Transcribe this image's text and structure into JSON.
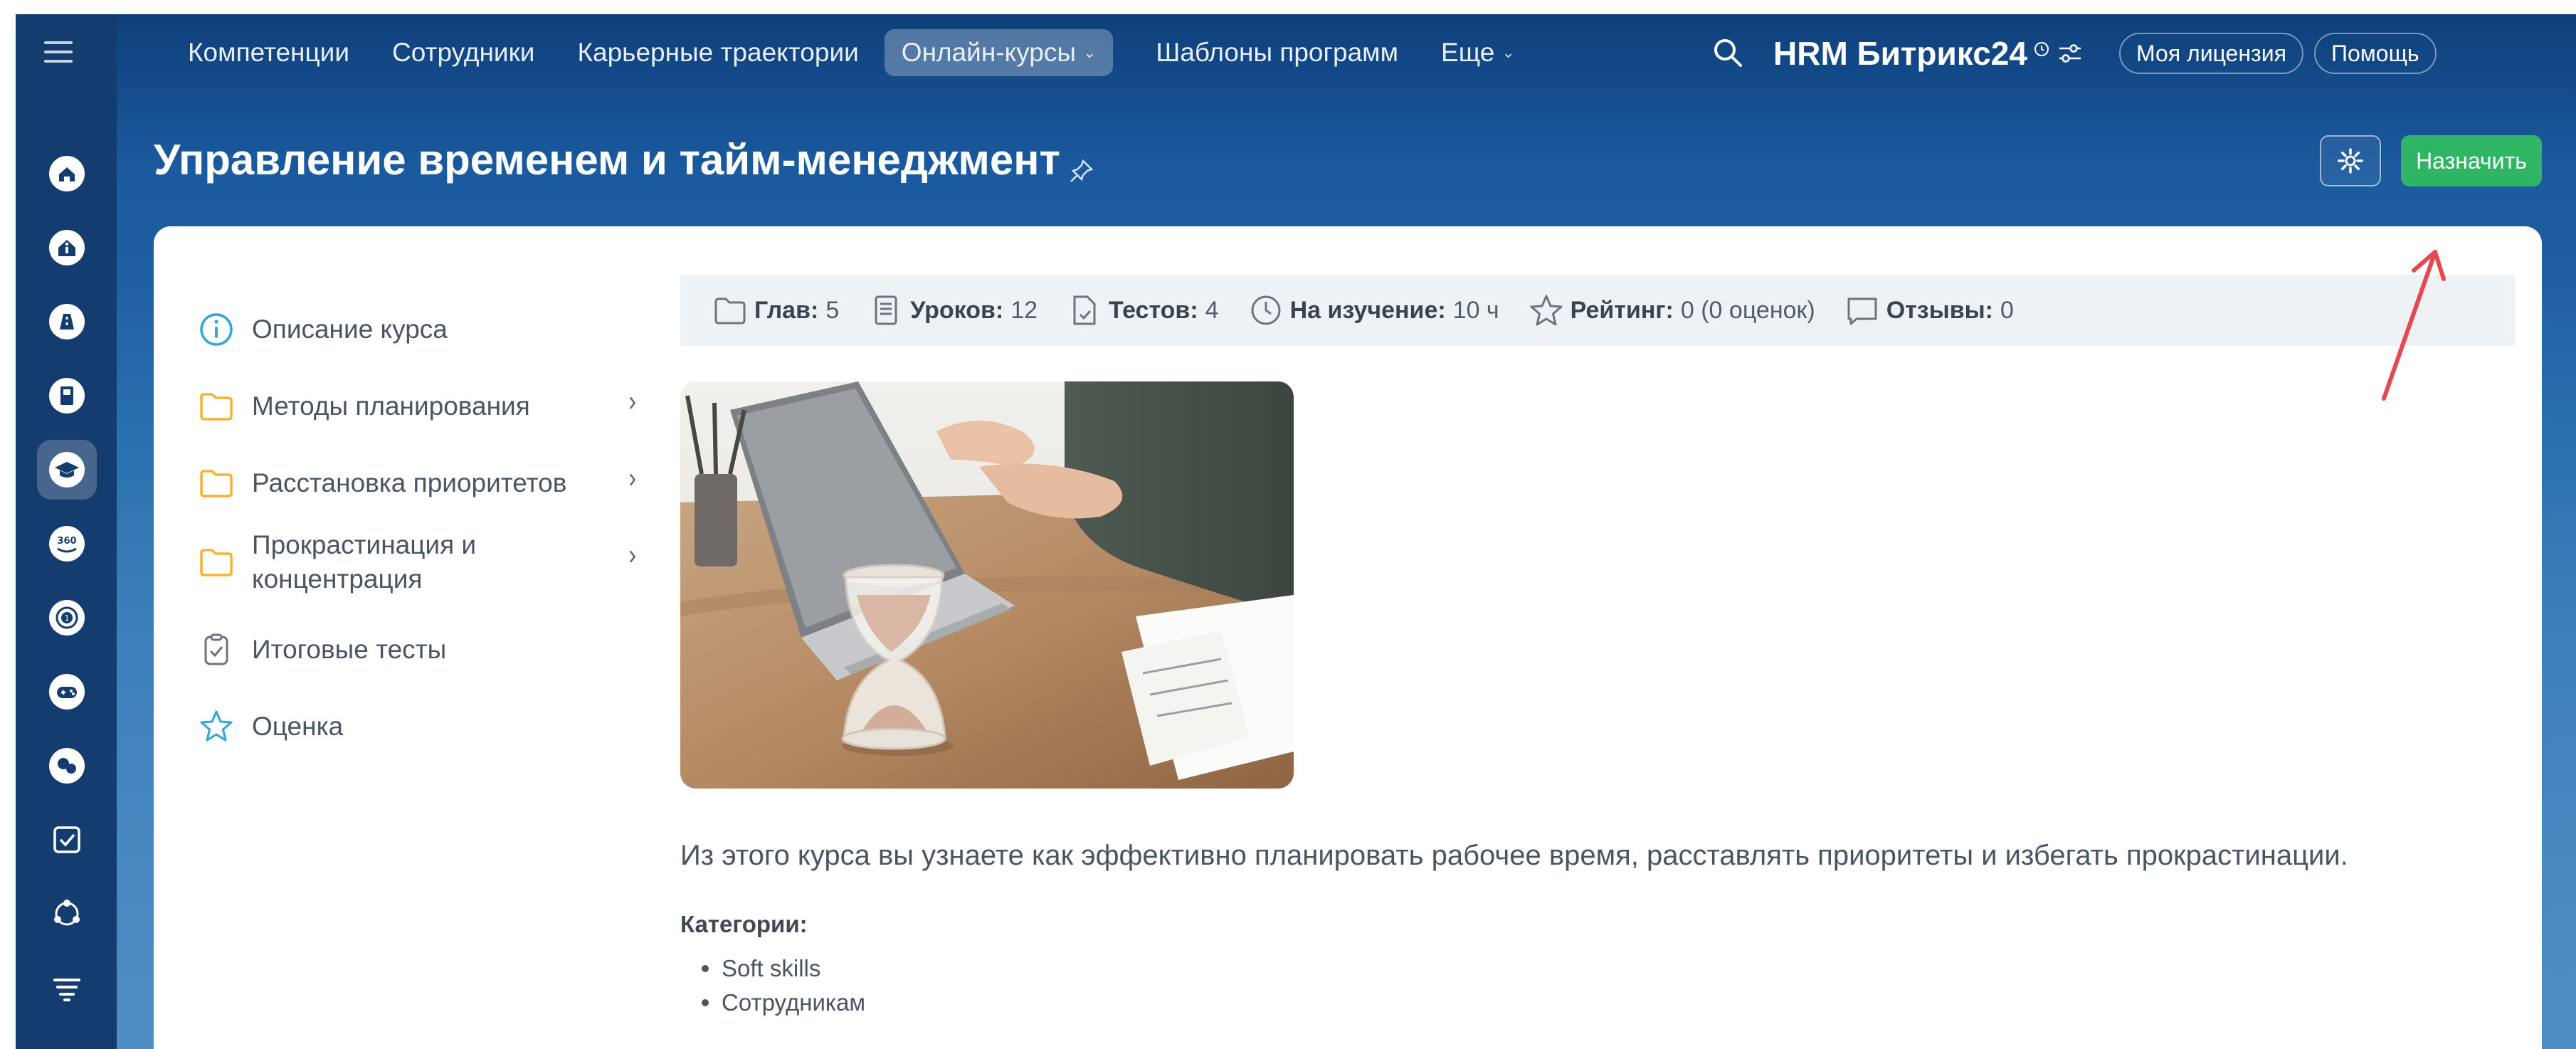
{
  "topnav": {
    "items": [
      {
        "label": "Компетенции"
      },
      {
        "label": "Сотрудники"
      },
      {
        "label": "Карьерные траектории"
      },
      {
        "label": "Онлайн-курсы",
        "active": true
      },
      {
        "label": "Шаблоны программ"
      },
      {
        "label": "Еще"
      }
    ],
    "brand": "HRM Битрикс24",
    "license_label": "Моя лицензия",
    "help_label": "Помощь"
  },
  "page": {
    "title": "Управление временем и тайм-менеджмент",
    "assign_label": "Назначить"
  },
  "course_menu": [
    {
      "label": "Описание курса",
      "icon": "info-icon"
    },
    {
      "label": "Методы планирования",
      "icon": "folder-icon",
      "has_children": true
    },
    {
      "label": "Расстановка приоритетов",
      "icon": "folder-icon",
      "has_children": true
    },
    {
      "label": "Прокрастинация и концентрация",
      "icon": "folder-icon",
      "has_children": true
    },
    {
      "label": "Итоговые тесты",
      "icon": "clipboard-check-icon"
    },
    {
      "label": "Оценка",
      "icon": "star-icon"
    }
  ],
  "stats": {
    "chapters_label": "Глав:",
    "chapters_value": "5",
    "lessons_label": "Уроков:",
    "lessons_value": "12",
    "tests_label": "Тестов:",
    "tests_value": "4",
    "study_label": "На изучение:",
    "study_value": "10 ч",
    "rating_label": "Рейтинг:",
    "rating_value": "0 (0 оценок)",
    "reviews_label": "Отзывы:",
    "reviews_value": "0"
  },
  "description": "Из этого курса вы узнаете как эффективно планировать рабочее время, расставлять приоритеты и избегать прокрастинации.",
  "categories": {
    "label": "Категории:",
    "items": [
      "Soft skills",
      "Сотрудникам"
    ]
  },
  "colors": {
    "accent_green": "#2fb564",
    "folder_yellow": "#f5b335",
    "info_blue": "#2fa8d8",
    "annotation_red": "#e5484d"
  }
}
